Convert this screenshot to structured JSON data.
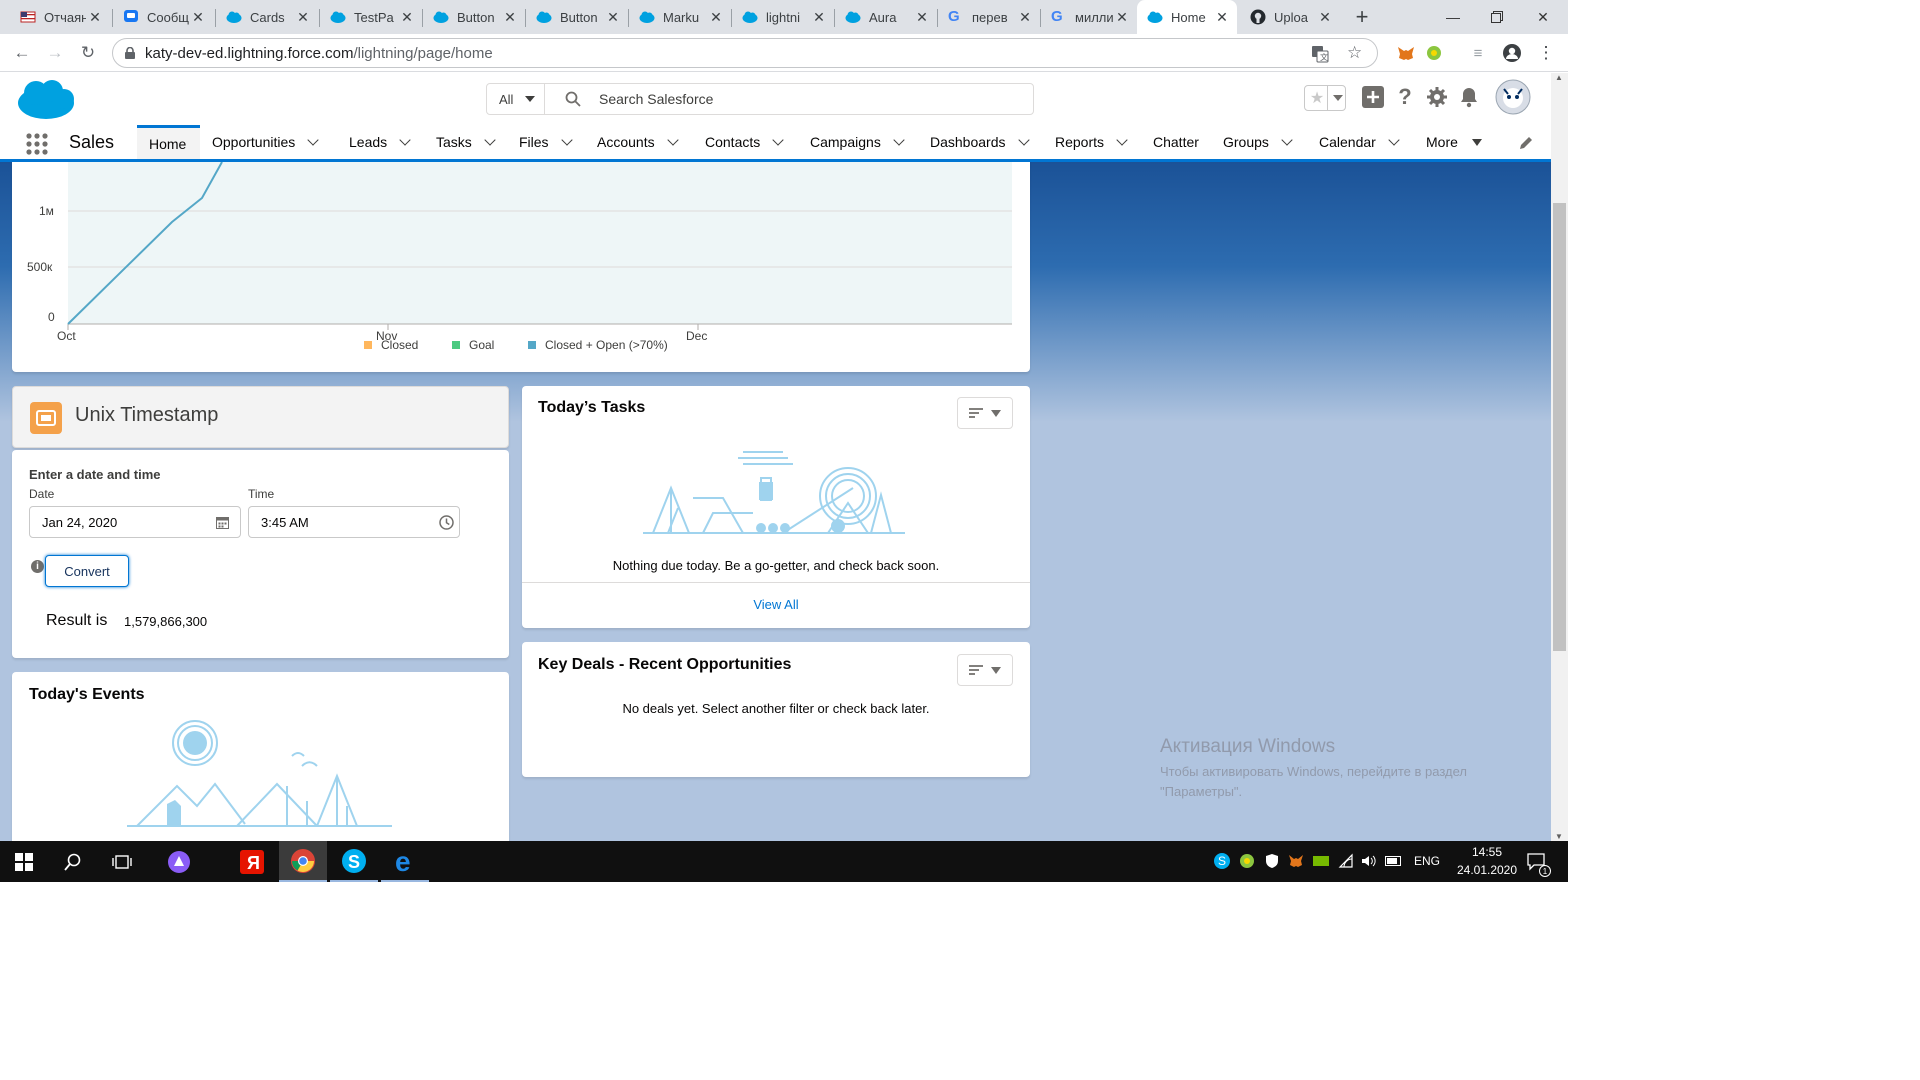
{
  "browser": {
    "tabs": [
      {
        "title": "Отчаян",
        "icon": "flag-icon"
      },
      {
        "title": "Сообщ",
        "icon": "chat-icon"
      },
      {
        "title": "Cards",
        "icon": "salesforce-cloud-icon"
      },
      {
        "title": "TestPa",
        "icon": "salesforce-cloud-icon"
      },
      {
        "title": "Button",
        "icon": "salesforce-cloud-icon"
      },
      {
        "title": "Button",
        "icon": "salesforce-cloud-icon"
      },
      {
        "title": "Marku",
        "icon": "salesforce-cloud-icon"
      },
      {
        "title": "lightni",
        "icon": "salesforce-cloud-icon"
      },
      {
        "title": "Aura",
        "icon": "salesforce-cloud-icon"
      },
      {
        "title": "перев",
        "icon": "google-icon"
      },
      {
        "title": "милли",
        "icon": "google-icon"
      },
      {
        "title": "Home",
        "icon": "salesforce-cloud-icon",
        "active": true
      },
      {
        "title": "Uploa",
        "icon": "github-icon"
      }
    ],
    "url_host": "katy-dev-ed.lightning.force.com",
    "url_path": "/lightning/page/home"
  },
  "sf": {
    "search_scope": "All",
    "search_placeholder": "Search Salesforce",
    "app_name": "Sales",
    "nav": [
      {
        "label": "Home",
        "active": true
      },
      {
        "label": "Opportunities",
        "dropdown": true
      },
      {
        "label": "Leads",
        "dropdown": true
      },
      {
        "label": "Tasks",
        "dropdown": true
      },
      {
        "label": "Files",
        "dropdown": true
      },
      {
        "label": "Accounts",
        "dropdown": true
      },
      {
        "label": "Contacts",
        "dropdown": true
      },
      {
        "label": "Campaigns",
        "dropdown": true
      },
      {
        "label": "Dashboards",
        "dropdown": true
      },
      {
        "label": "Reports",
        "dropdown": true
      },
      {
        "label": "Chatter"
      },
      {
        "label": "Groups",
        "dropdown": true
      },
      {
        "label": "Calendar",
        "dropdown": true
      },
      {
        "label": "More",
        "dropdown": true
      }
    ]
  },
  "performance_chart": {
    "y_ticks": [
      "1м",
      "500к",
      "0"
    ],
    "x_ticks": [
      "Oct",
      "Nov",
      "Dec"
    ],
    "legend": [
      {
        "label": "Closed",
        "color": "#ffb75d"
      },
      {
        "label": "Goal",
        "color": "#4bca81"
      },
      {
        "label": "Closed + Open (>70%)",
        "color": "#54a7c7"
      }
    ]
  },
  "unix_timestamp": {
    "title": "Unix Timestamp",
    "form_heading": "Enter a date and time",
    "date_label": "Date",
    "date_value": "Jan 24, 2020",
    "time_label": "Time",
    "time_value": "3:45 AM",
    "convert_label": "Convert",
    "result_label": "Result is",
    "result_value": "1,579,866,300"
  },
  "todays_tasks": {
    "title": "Today’s Tasks",
    "empty_text": "Nothing due today. Be a go-getter, and check back soon.",
    "view_all": "View All"
  },
  "key_deals": {
    "title": "Key Deals - Recent Opportunities",
    "empty_text": "No deals yet. Select another filter or check back later."
  },
  "todays_events": {
    "title": "Today's Events"
  },
  "watermark": {
    "title": "Активация Windows",
    "line1": "Чтобы активировать Windows, перейдите в раздел",
    "line2": "\"Параметры\"."
  },
  "taskbar": {
    "lang": "ENG",
    "time": "14:55",
    "date": "24.01.2020",
    "notification_count": "1"
  },
  "colors": {
    "brand": "#0176d3",
    "chart_line": "#54a7c7",
    "chart_fill": "#eef6f7",
    "illustration": "#9fd3ee"
  }
}
